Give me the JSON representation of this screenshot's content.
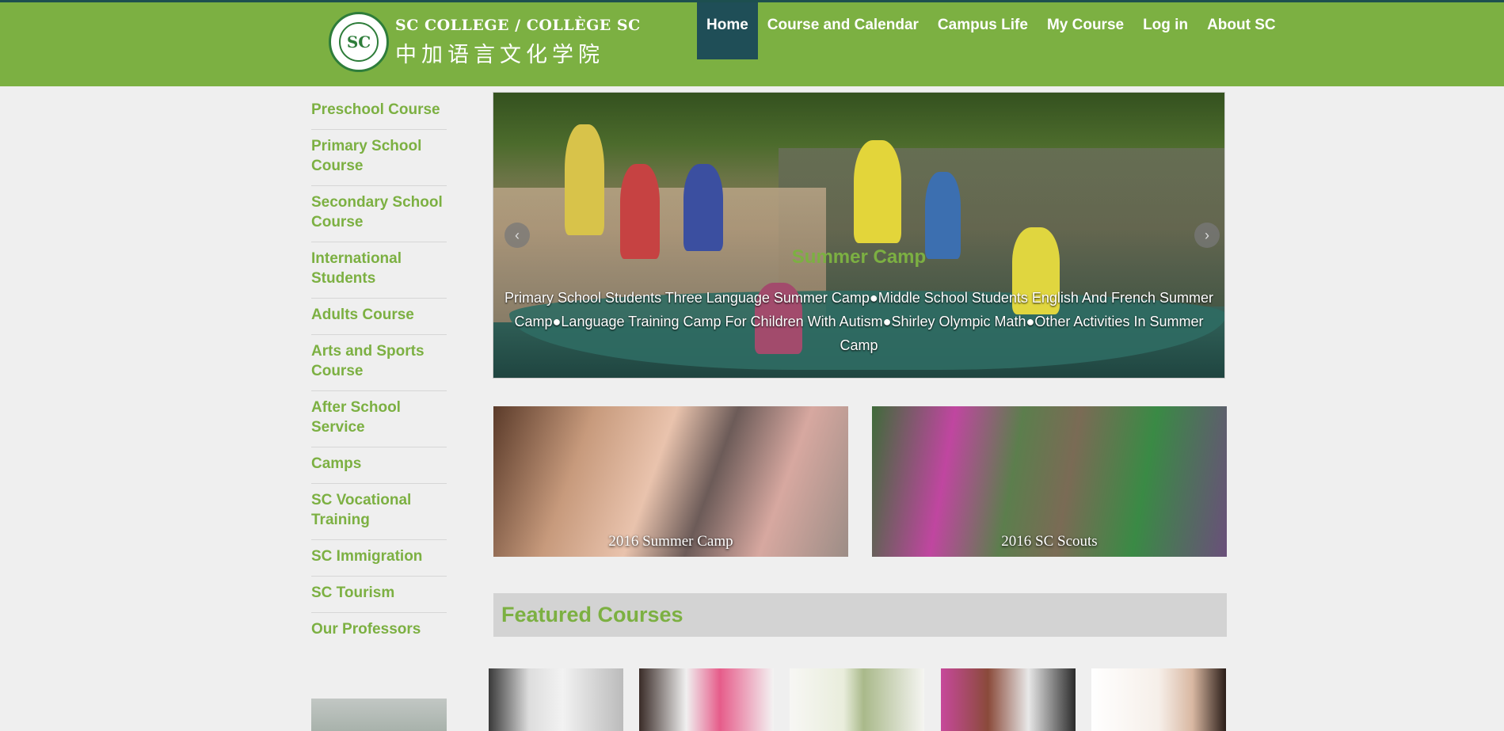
{
  "header": {
    "logo_en": "SC COLLEGE / COLLÈGE SC",
    "logo_zh": "中加语言文化学院",
    "logo_seal": "SC",
    "nav": [
      {
        "label": "Home",
        "active": true
      },
      {
        "label": "Course and Calendar",
        "active": false
      },
      {
        "label": "Campus Life",
        "active": false
      },
      {
        "label": "My Course",
        "active": false
      },
      {
        "label": "Log in",
        "active": false
      },
      {
        "label": "About SC",
        "active": false
      }
    ]
  },
  "sidebar": {
    "items": [
      {
        "label": "Preschool Course"
      },
      {
        "label": "Primary School Course"
      },
      {
        "label": "Secondary School Course"
      },
      {
        "label": "International Students"
      },
      {
        "label": "Adults Course"
      },
      {
        "label": "Arts and Sports Course"
      },
      {
        "label": "After School Service"
      },
      {
        "label": "Camps"
      },
      {
        "label": "SC Vocational Training"
      },
      {
        "label": "SC Immigration"
      },
      {
        "label": "SC Tourism"
      },
      {
        "label": "Our Professors"
      }
    ]
  },
  "hero": {
    "title": "Summer Camp",
    "description": "Primary School Students Three Language Summer Camp●Middle School Students English And French Summer Camp●Language Training Camp For Children With Autism●Shirley Olympic Math●Other Activities In Summer Camp",
    "prev_icon": "‹",
    "next_icon": "›"
  },
  "cards": [
    {
      "caption": "2016 Summer Camp"
    },
    {
      "caption": "2016 SC Scouts"
    }
  ],
  "featured": {
    "heading": "Featured Courses"
  },
  "colors": {
    "brand_green": "#7cb042",
    "nav_active": "#1f4e57",
    "background": "#efefef"
  }
}
